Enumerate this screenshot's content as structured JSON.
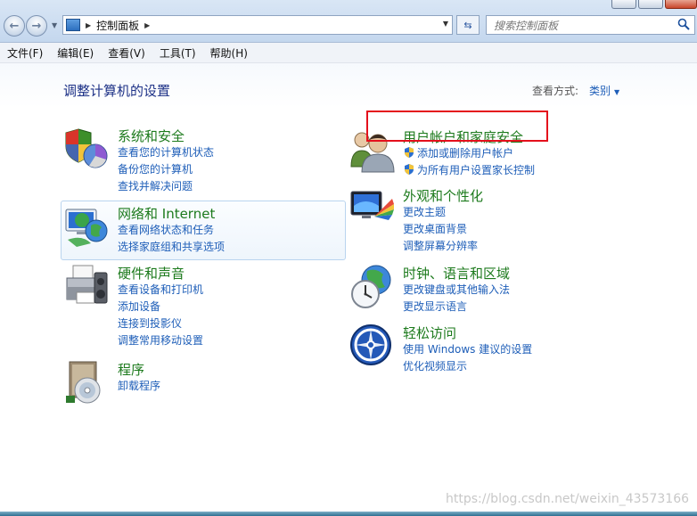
{
  "address": {
    "crumb": "控制面板",
    "search_placeholder": "搜索控制面板"
  },
  "menu": [
    "文件(F)",
    "编辑(E)",
    "查看(V)",
    "工具(T)",
    "帮助(H)"
  ],
  "page": {
    "title": "调整计算机的设置",
    "view_by_label": "查看方式:",
    "view_by_value": "类别"
  },
  "categories": {
    "system": {
      "title": "系统和安全",
      "links": [
        "查看您的计算机状态",
        "备份您的计算机",
        "查找并解决问题"
      ]
    },
    "network": {
      "title": "网络和 Internet",
      "links": [
        "查看网络状态和任务",
        "选择家庭组和共享选项"
      ]
    },
    "hardware": {
      "title": "硬件和声音",
      "links": [
        "查看设备和打印机",
        "添加设备",
        "连接到投影仪",
        "调整常用移动设置"
      ]
    },
    "programs": {
      "title": "程序",
      "links": [
        "卸载程序"
      ]
    },
    "users": {
      "title": "用户帐户和家庭安全",
      "links": [
        "添加或删除用户帐户",
        "为所有用户设置家长控制"
      ]
    },
    "appearance": {
      "title": "外观和个性化",
      "links": [
        "更改主题",
        "更改桌面背景",
        "调整屏幕分辨率"
      ]
    },
    "clock": {
      "title": "时钟、语言和区域",
      "links": [
        "更改键盘或其他输入法",
        "更改显示语言"
      ]
    },
    "ease": {
      "title": "轻松访问",
      "links": [
        "使用 Windows 建议的设置",
        "优化视频显示"
      ]
    }
  },
  "watermark": "https://blog.csdn.net/weixin_43573166"
}
